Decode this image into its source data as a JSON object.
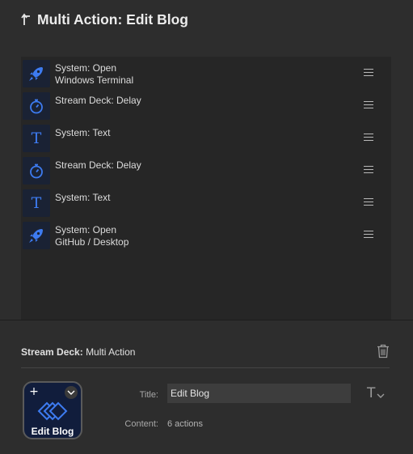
{
  "header": {
    "back_icon": "back-arrow-icon",
    "title": "Multi Action: Edit Blog"
  },
  "actions": [
    {
      "icon": "rocket-icon",
      "line1": "System: Open",
      "line2": "Windows Terminal"
    },
    {
      "icon": "stopwatch-icon",
      "line1": "Stream Deck: Delay",
      "line2": ""
    },
    {
      "icon": "text-t-icon",
      "line1": "System: Text",
      "line2": ""
    },
    {
      "icon": "stopwatch-icon",
      "line1": "Stream Deck: Delay",
      "line2": ""
    },
    {
      "icon": "text-t-icon",
      "line1": "System: Text",
      "line2": ""
    },
    {
      "icon": "rocket-icon",
      "line1": "System: Open",
      "line2": "GitHub / Desktop"
    }
  ],
  "panel": {
    "plugin": "Stream Deck:",
    "action_type": "Multi Action",
    "key": {
      "title": "Edit Blog"
    },
    "title_label": "Title:",
    "title_value": "Edit Blog",
    "content_label": "Content:",
    "content_value": "6 actions"
  },
  "colors": {
    "accent": "#3d7bf0",
    "background": "#2d2d2d",
    "list_background": "#262626",
    "icon_tile": "#1a2234"
  }
}
